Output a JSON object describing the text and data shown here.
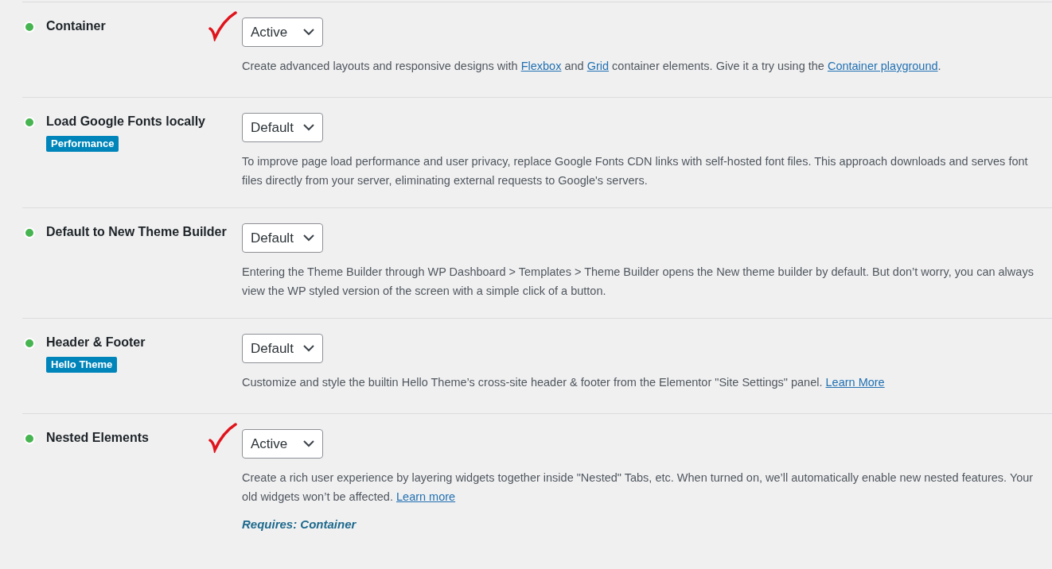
{
  "features": [
    {
      "title": "Container",
      "checkmark": true,
      "select": {
        "value": "Active"
      },
      "description": [
        {
          "kind": "text",
          "text": "Create advanced layouts and responsive designs with "
        },
        {
          "kind": "link",
          "text": "Flexbox"
        },
        {
          "kind": "text",
          "text": " and "
        },
        {
          "kind": "link",
          "text": "Grid"
        },
        {
          "kind": "text",
          "text": " container elements. Give it a try using the "
        },
        {
          "kind": "link",
          "text": "Container playground"
        },
        {
          "kind": "text",
          "text": "."
        }
      ]
    },
    {
      "title": "Load Google Fonts locally",
      "badge": "Performance",
      "checkmark": false,
      "select": {
        "value": "Default"
      },
      "description": [
        {
          "kind": "text",
          "text": "To improve page load performance and user privacy, replace Google Fonts CDN links with self-hosted font files. This approach downloads and serves font files directly from your server, eliminating external requests to Google's servers."
        }
      ]
    },
    {
      "title": "Default to New Theme Builder",
      "checkmark": false,
      "select": {
        "value": "Default"
      },
      "description": [
        {
          "kind": "text",
          "text": "Entering the Theme Builder through WP Dashboard > Templates > Theme Builder opens the New theme builder by default. But don’t worry, you can always view the WP styled version of the screen with a simple click of a button."
        }
      ]
    },
    {
      "title": "Header & Footer",
      "badge": "Hello Theme",
      "checkmark": false,
      "select": {
        "value": "Default"
      },
      "description": [
        {
          "kind": "text",
          "text": "Customize and style the builtin Hello Theme’s cross-site header & footer from the Elementor \"Site Settings\" panel. "
        },
        {
          "kind": "link",
          "text": "Learn More"
        }
      ]
    },
    {
      "title": "Nested Elements",
      "checkmark": true,
      "select": {
        "value": "Active"
      },
      "description": [
        {
          "kind": "text",
          "text": "Create a rich user experience by layering widgets together inside \"Nested\" Tabs, etc. When turned on, we’ll automatically enable new nested features. Your old widgets won’t be affected. "
        },
        {
          "kind": "link",
          "text": "Learn more"
        }
      ],
      "requires": "Requires: Container"
    }
  ]
}
